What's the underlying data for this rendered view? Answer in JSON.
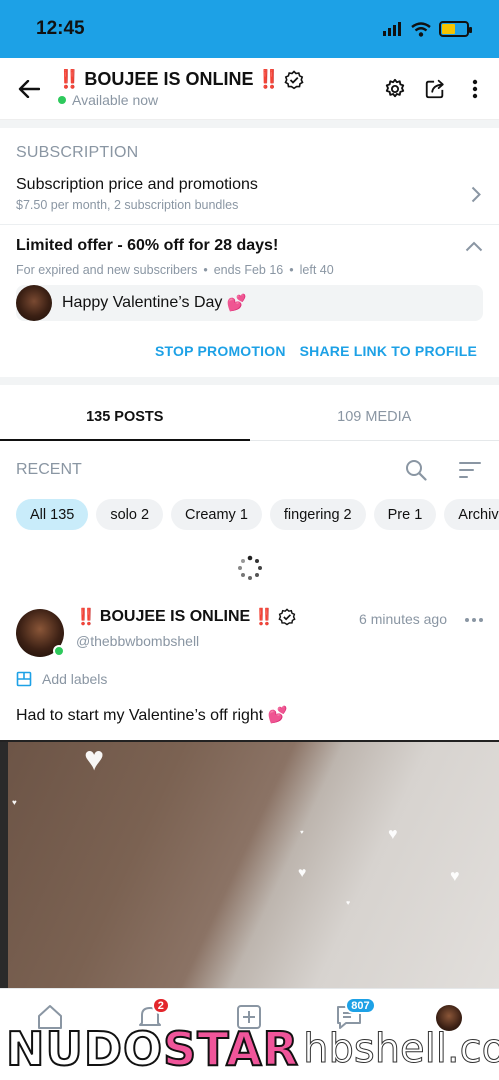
{
  "status_bar": {
    "time": "12:45"
  },
  "header": {
    "title_prefix": "‼️",
    "title": "BOUJEE IS ONLINE",
    "title_suffix": "‼️",
    "status": "Available now"
  },
  "subscription": {
    "section_label": "SUBSCRIPTION",
    "row_title": "Subscription price and promotions",
    "row_desc": "$7.50 per month, 2 subscription bundles"
  },
  "offer": {
    "title": "Limited offer - 60% off for 28 days!",
    "meta_audience": "For expired and new subscribers",
    "meta_ends": "ends Feb 16",
    "meta_left": "left 40",
    "message": "Happy Valentine’s Day",
    "message_emoji": "💕",
    "stop_label": "STOP PROMOTION",
    "share_label": "SHARE LINK TO PROFILE"
  },
  "tabs": [
    {
      "label": "135 POSTS"
    },
    {
      "label": "109 MEDIA"
    }
  ],
  "recent": {
    "label": "RECENT"
  },
  "chips": [
    {
      "label": "All 135"
    },
    {
      "label": "solo 2"
    },
    {
      "label": "Creamy 1"
    },
    {
      "label": "fingering 2"
    },
    {
      "label": "Pre 1"
    },
    {
      "label": "Archiv"
    }
  ],
  "post": {
    "name_prefix": "‼️",
    "name": "BOUJEE IS ONLINE",
    "name_suffix": "‼️",
    "handle": "@thebbwbombshell",
    "time": "6 minutes ago",
    "add_labels": "Add labels",
    "text": "Had to start my Valentine’s off right",
    "text_emoji": "💕"
  },
  "bottom_nav": {
    "notifications_badge": "2",
    "messages_badge": "807"
  },
  "watermark": {
    "part_a": "NUDO",
    "part_b": "STAR",
    "part_c": "hbshell.co"
  },
  "colors": {
    "accent": "#1da1e6",
    "online": "#2ec95c",
    "badge_red": "#e3262c",
    "muted": "#8a96a3"
  }
}
